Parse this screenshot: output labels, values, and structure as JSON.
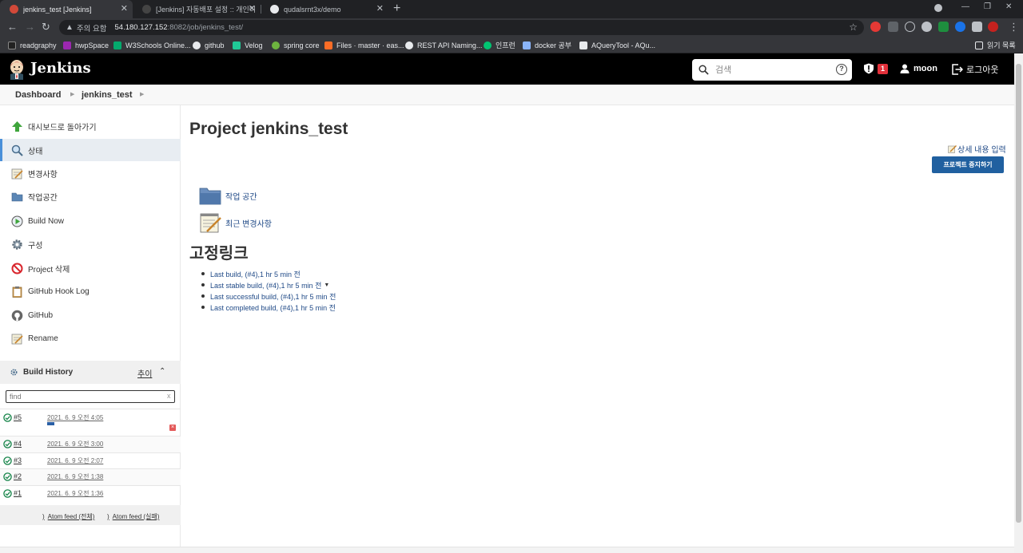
{
  "browser": {
    "tabs": [
      {
        "title": "jenkins_test [Jenkins]",
        "active": true
      },
      {
        "title": "[Jenkins] 자동배포 설정 :: 개인이",
        "active": false
      },
      {
        "title": "qudalsrnt3x/demo",
        "active": false
      }
    ],
    "address": {
      "security_label": "주의 요함",
      "host": "54.180.127.152",
      "path": ":8082/job/jenkins_test/"
    },
    "bookmarks": [
      "readgraphy",
      "hwpSpace",
      "W3Schools Online...",
      "github",
      "Velog",
      "spring core",
      "Files · master · eas...",
      "REST API Naming...",
      "인프런",
      "docker 공부",
      "AQueryTool - AQu..."
    ],
    "reading_list": "읽기 목록"
  },
  "header": {
    "app_name": "Jenkins",
    "search_placeholder": "검색",
    "alert_count": "1",
    "user": "moon",
    "logout": "로그아웃"
  },
  "breadcrumb": [
    "Dashboard",
    "jenkins_test"
  ],
  "sidebar": {
    "tasks": [
      {
        "label": "대시보드로 돌아가기",
        "icon": "up-arrow-icon"
      },
      {
        "label": "상태",
        "icon": "search-icon"
      },
      {
        "label": "변경사항",
        "icon": "notepad-icon"
      },
      {
        "label": "작업공간",
        "icon": "folder-icon"
      },
      {
        "label": "Build Now",
        "icon": "clock-icon"
      },
      {
        "label": "구성",
        "icon": "gear-icon"
      },
      {
        "label": "Project 삭제",
        "icon": "no-entry-icon"
      },
      {
        "label": "GitHub Hook Log",
        "icon": "clipboard-icon"
      },
      {
        "label": "GitHub",
        "icon": "github-icon"
      },
      {
        "label": "Rename",
        "icon": "notepad-icon"
      }
    ],
    "build_history": {
      "title": "Build History",
      "trend": "추이",
      "filter_placeholder": "find",
      "builds": [
        {
          "number": "#5",
          "date": "2021. 6. 9 오전 4:05"
        },
        {
          "number": "#4",
          "date": "2021. 6. 9 오전 3:00"
        },
        {
          "number": "#3",
          "date": "2021. 6. 9 오전 2:07"
        },
        {
          "number": "#2",
          "date": "2021. 6. 9 오전 1:38"
        },
        {
          "number": "#1",
          "date": "2021. 6. 9 오전 1:36"
        }
      ],
      "feeds": [
        "Atom feed (전체)",
        "Atom feed (실패)"
      ]
    }
  },
  "main": {
    "title": "Project jenkins_test",
    "edit_description": "상세 내용 입력",
    "disable_button": "프로젝트 중지하기",
    "links": [
      "작업 공간",
      "최근 변경사항"
    ],
    "permalinks_title": "고정링크",
    "permalinks": [
      "Last build, (#4),1 hr 5 min 전",
      "Last stable build, (#4),1 hr 5 min 전",
      "Last successful build, (#4),1 hr 5 min 전",
      "Last completed build, (#4),1 hr 5 min 전"
    ]
  },
  "colors": {
    "header_bg": "#000000",
    "link": "#204a87",
    "button": "#2060a0",
    "success": "#138347",
    "alert": "#e2303a"
  }
}
